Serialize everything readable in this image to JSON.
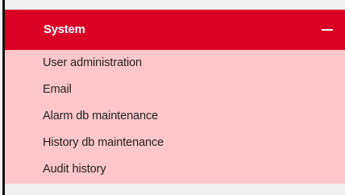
{
  "panel": {
    "title": "System",
    "collapse_icon": "minus-icon",
    "header_color": "#d90026",
    "body_color": "#ffc6cc"
  },
  "menu": {
    "items": [
      {
        "label": "User administration"
      },
      {
        "label": "Email"
      },
      {
        "label": "Alarm db maintenance"
      },
      {
        "label": "History db maintenance"
      },
      {
        "label": "Audit history"
      }
    ]
  }
}
